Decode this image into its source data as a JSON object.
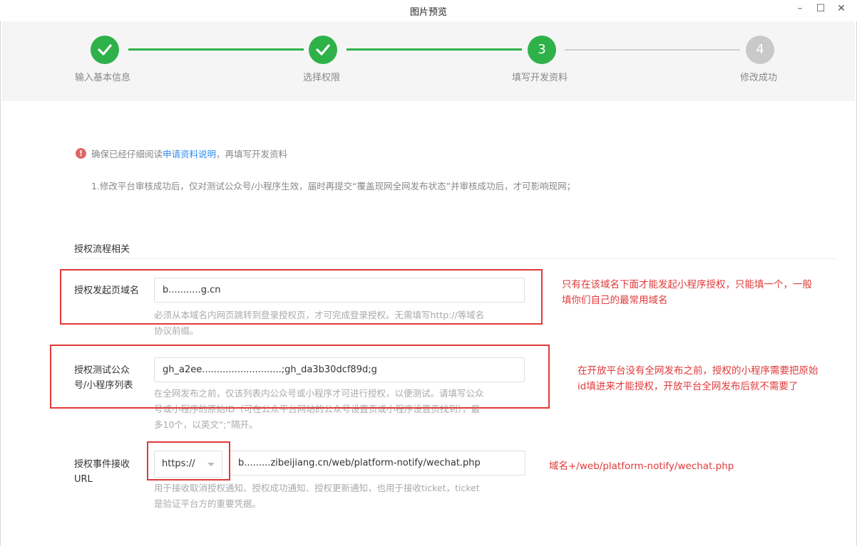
{
  "window": {
    "title": "图片预览"
  },
  "steps": [
    {
      "label": "输入基本信息",
      "state": "done",
      "number": ""
    },
    {
      "label": "选择权限",
      "state": "done",
      "number": ""
    },
    {
      "label": "填写开发资料",
      "state": "active",
      "number": "3"
    },
    {
      "label": "修改成功",
      "state": "todo",
      "number": "4"
    }
  ],
  "notice": {
    "prefix": "确保已经仔细阅读",
    "link": "申请资料说明",
    "suffix": "，再填写开发资料",
    "line1": "1.修改平台审核成功后，仅对测试公众号/小程序生效，届时再提交“覆盖现网全网发布状态”并审核成功后，才可影响现网；"
  },
  "section": {
    "title": "授权流程相关"
  },
  "form": {
    "domain": {
      "label": "授权发起页域名",
      "value": "b...........g.cn",
      "help_line1": "必须从本域名内网页跳转到登录授权页，才可完成登录授权。无需填写http://等域名",
      "help_line2": "协议前缀。"
    },
    "test_accounts": {
      "label_line1": "授权测试公众",
      "label_line2": "号/小程序列表",
      "value": "gh_a2ee...........................;gh_da3b30dcf89d;g",
      "help_line1": "在全网发布之前，仅该列表内公众号或小程序才可进行授权，以便测试。请填写公众",
      "help_line2": "号或小程序的原始ID（可在公众平台网站的公众号设置页或小程序设置页找到），最",
      "help_line3": "多10个，以英文“;”隔开。"
    },
    "event_url": {
      "label_line1": "授权事件接收",
      "label_line2": "URL",
      "protocol": "https://",
      "value": "b.........zibeijiang.cn/web/platform-notify/wechat.php",
      "help_line1": "用于接收取消授权通知、授权成功通知、授权更新通知，也用于接收ticket，ticket",
      "help_line2": "是验证平台方的重要凭据。"
    }
  },
  "annotations": {
    "a1_line1": "只有在该域名下面才能发起小程序授权，只能填一个，一般",
    "a1_line2": "填你们自己的最常用域名",
    "a2_line1": "在开放平台没有全网发布之前，授权的小程序需要把原始",
    "a2_line2": "id填进来才能授权，开放平台全网发布后就不需要了",
    "a3": "域名+/web/platform-notify/wechat.php"
  },
  "colors": {
    "success": "#2fb14a",
    "pending": "#c9c9c9",
    "annotation": "#e03a3a",
    "link": "#2d8cf0"
  }
}
